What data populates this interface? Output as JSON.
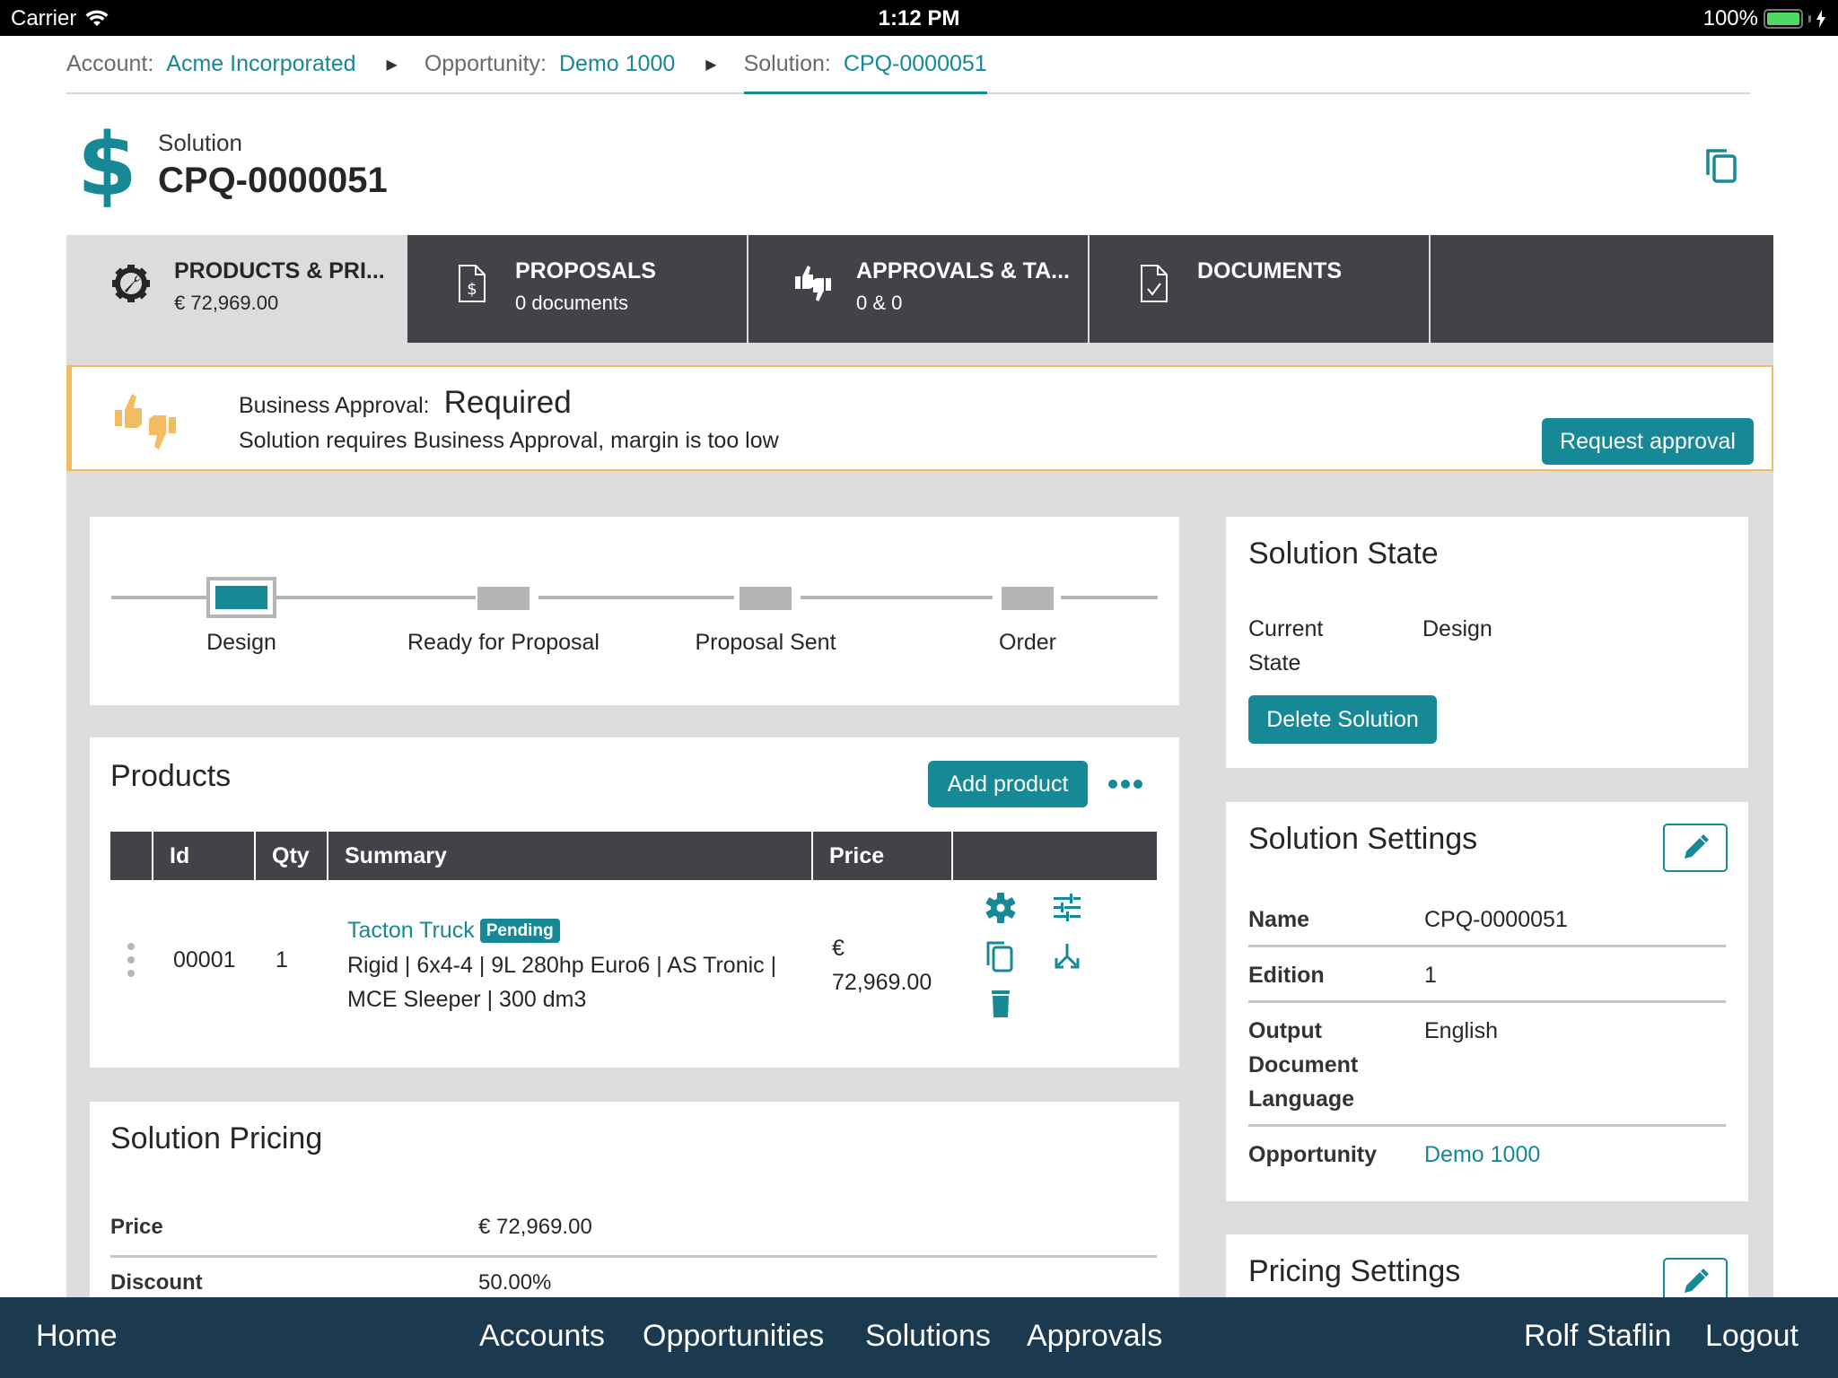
{
  "status_bar": {
    "carrier": "Carrier",
    "time": "1:12 PM",
    "battery": "100%"
  },
  "breadcrumb": [
    {
      "label": "Account:",
      "value": "Acme Incorporated"
    },
    {
      "label": "Opportunity:",
      "value": "Demo 1000"
    },
    {
      "label": "Solution:",
      "value": "CPQ-0000051"
    }
  ],
  "header": {
    "icon": "dollar-icon",
    "subtitle": "Solution",
    "title": "CPQ-0000051",
    "copy_icon": "copy-icon"
  },
  "tabs": [
    {
      "label": "PRODUCTS & PRI...",
      "sub": "€ 72,969.00",
      "icon": "gear-wrench-icon",
      "active": true
    },
    {
      "label": "PROPOSALS",
      "sub": "0 documents",
      "icon": "document-dollar-icon",
      "active": false
    },
    {
      "label": "APPROVALS & TA...",
      "sub": "0 & 0",
      "icon": "thumbs-up-down-icon",
      "active": false
    },
    {
      "label": "DOCUMENTS",
      "sub": "",
      "icon": "document-check-icon",
      "active": false
    }
  ],
  "alert": {
    "label": "Business Approval:",
    "status": "Required",
    "message": "Solution requires Business Approval, margin is too low",
    "button": "Request approval",
    "accent_color": "#f2bd62"
  },
  "stepper": {
    "steps": [
      "Design",
      "Ready for Proposal",
      "Proposal Sent",
      "Order"
    ],
    "current": "Design"
  },
  "products": {
    "title": "Products",
    "add_button": "Add product",
    "columns": [
      "",
      "Id",
      "Qty",
      "Summary",
      "Price",
      ""
    ],
    "rows": [
      {
        "id": "00001",
        "qty": "1",
        "name": "Tacton Truck",
        "badge": "Pending",
        "summary": "Rigid | 6x4-4 | 9L 280hp Euro6 | AS Tronic | MCE Sleeper | 300 dm3",
        "summary_line1": "Rigid | 6x4-4 | 9L 280hp Euro6 | AS Tronic |",
        "summary_line2": "MCE Sleeper | 300 dm3",
        "price_currency": "€",
        "price_value": "72,969.00"
      }
    ]
  },
  "pricing": {
    "title": "Solution Pricing",
    "rows": [
      {
        "label": "Price",
        "value": "€ 72,969.00"
      },
      {
        "label": "Discount",
        "value": "50.00%"
      }
    ]
  },
  "solution_state": {
    "title": "Solution State",
    "label_line1": "Current",
    "label_line2": "State",
    "value": "Design",
    "delete_button": "Delete Solution"
  },
  "solution_settings": {
    "title": "Solution Settings",
    "rows": [
      {
        "label": "Name",
        "value": "CPQ-0000051"
      },
      {
        "label": "Edition",
        "value": "1"
      },
      {
        "label": "Output Document Language",
        "label_lines": [
          "Output",
          "Document",
          "Language"
        ],
        "value": "English"
      },
      {
        "label": "Opportunity",
        "value": "Demo 1000"
      }
    ]
  },
  "pricing_settings": {
    "title": "Pricing Settings"
  },
  "bottom_nav": {
    "home": "Home",
    "items": [
      "Accounts",
      "Opportunities",
      "Solutions",
      "Approvals"
    ],
    "user": "Rolf Staflin",
    "logout": "Logout"
  },
  "colors": {
    "accent": "#168896",
    "tab_dark": "#434249",
    "nav_bg": "#1b3a4f",
    "warning": "#f2bd62"
  }
}
